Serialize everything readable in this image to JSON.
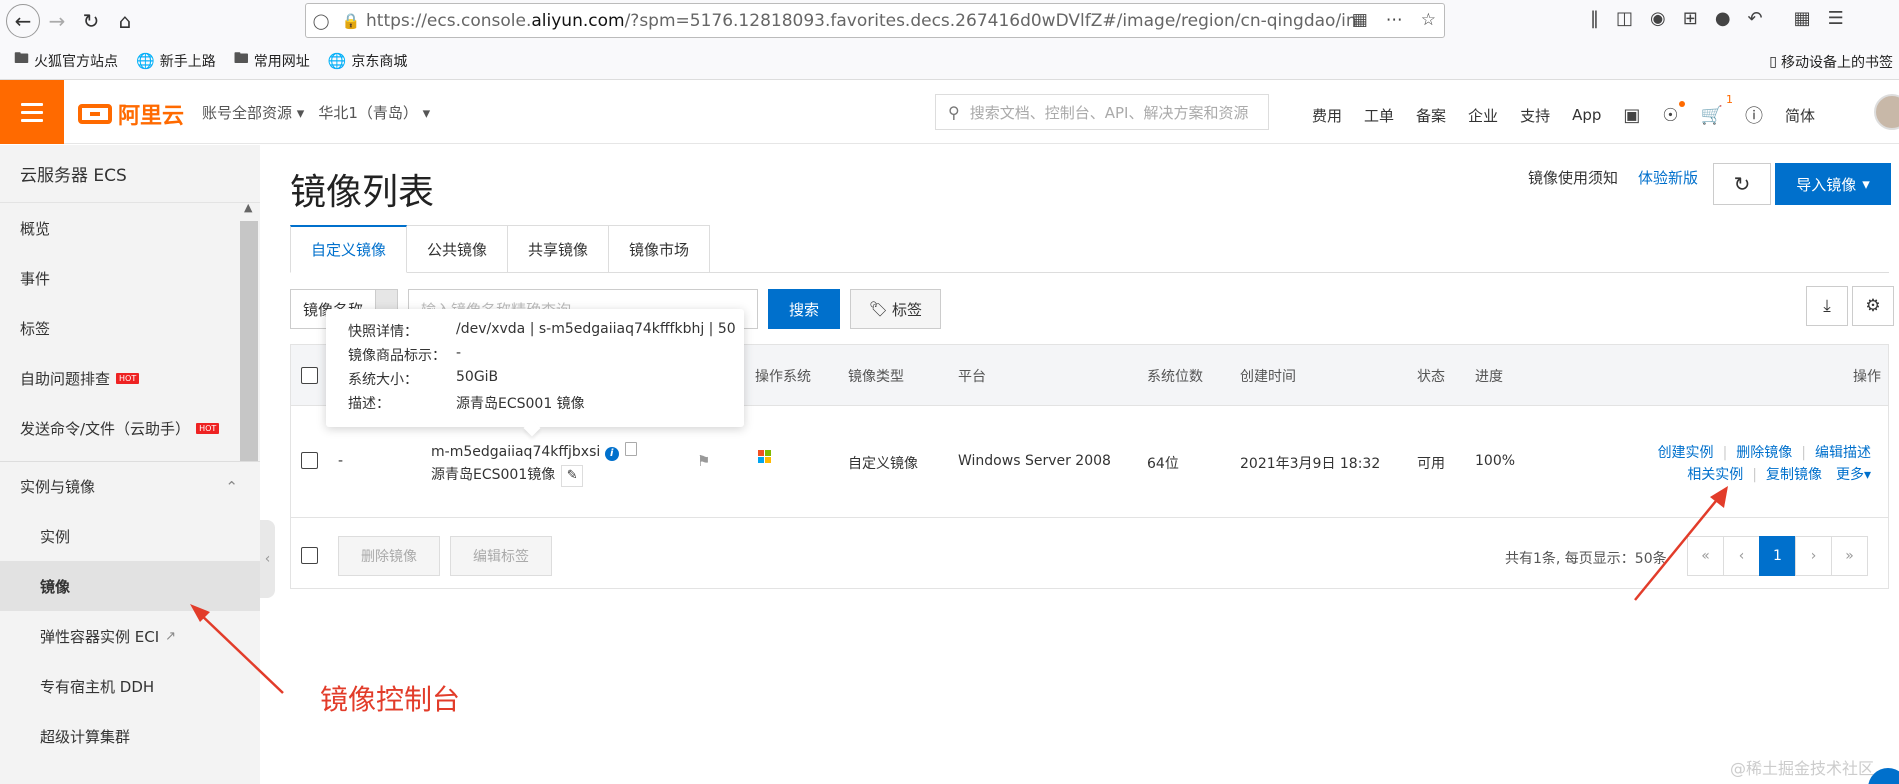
{
  "browser": {
    "url_prefix": "https://ecs.console.",
    "url_domain": "aliyun.com",
    "url_rest": "/?spm=5176.12818093.favorites.decs.267416d0wDVlfZ#/image/region/cn-qingdao/in",
    "bookmarks": [
      "火狐官方站点",
      "新手上路",
      "常用网址",
      "京东商城"
    ],
    "mobile_bookmarks": "移动设备上的书签"
  },
  "header": {
    "logo_text": "阿里云",
    "account": "账号全部资源",
    "region": "华北1（青岛）",
    "search_placeholder": "搜索文档、控制台、API、解决方案和资源",
    "links": [
      "费用",
      "工单",
      "备案",
      "企业",
      "支持",
      "App"
    ],
    "cart_count": "1",
    "language": "简体"
  },
  "sidebar": {
    "title": "云服务器 ECS",
    "items": [
      "概览",
      "事件",
      "标签"
    ],
    "self_help": "自助问题排查",
    "send_cmd": "发送命令/文件（云助手）",
    "hot": "HOT",
    "group": "实例与镜像",
    "sub_items": [
      "实例",
      "镜像",
      "弹性容器实例 ECI",
      "专有宿主机 DDH",
      "超级计算集群"
    ]
  },
  "main": {
    "title": "镜像列表",
    "notice_link": "镜像使用须知",
    "new_version_link": "体验新版",
    "import_button": "导入镜像",
    "tabs": [
      "自定义镜像",
      "公共镜像",
      "共享镜像",
      "镜像市场"
    ],
    "filter_select": "镜像名称",
    "filter_placeholder": "输入镜像名称精确查询",
    "search_button": "搜索",
    "tag_button": "标签"
  },
  "table": {
    "headers": [
      "操作系统",
      "镜像类型",
      "平台",
      "系统位数",
      "创建时间",
      "状态",
      "进度",
      "操作"
    ],
    "row": {
      "dash": "-",
      "image_id": "m-m5edgaiiaq74kffjbxsi",
      "image_name": "源青岛ECS001镜像",
      "image_type": "自定义镜像",
      "platform": "Windows Server 2008",
      "bits": "64位",
      "created": "2021年3月9日 18:32",
      "status": "可用",
      "progress": "100%",
      "actions": [
        "创建实例",
        "删除镜像",
        "编辑描述",
        "相关实例",
        "复制镜像",
        "更多"
      ]
    },
    "bulk_delete": "删除镜像",
    "bulk_edit_tags": "编辑标签",
    "pager_info": "共有1条, 每页显示：50条",
    "pager": [
      "«",
      "‹",
      "1",
      "›",
      "»"
    ]
  },
  "tooltip": {
    "rows": [
      {
        "k": "快照详情：",
        "v": "/dev/xvda | s-m5edgaiiaq74kfffkbhj | 50"
      },
      {
        "k": "镜像商品标示：",
        "v": "-"
      },
      {
        "k": "系统大小：",
        "v": "50GiB"
      },
      {
        "k": "描述：",
        "v": "源青岛ECS001 镜像"
      }
    ]
  },
  "annotation": "镜像控制台",
  "watermark": "@稀土掘金技术社区",
  "colors": {
    "brand": "#ff6a00",
    "primary": "#0070cc",
    "annotation": "#e23c2a"
  }
}
